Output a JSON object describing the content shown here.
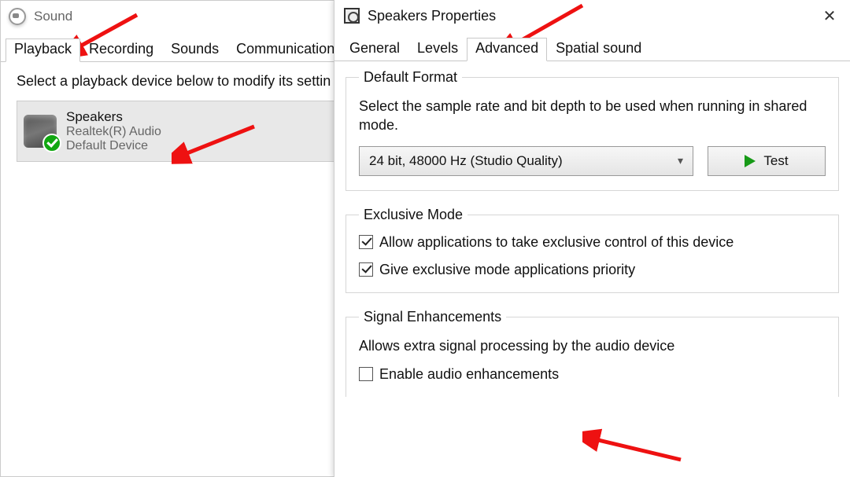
{
  "sound_dialog": {
    "title": "Sound",
    "tabs": [
      "Playback",
      "Recording",
      "Sounds",
      "Communications"
    ],
    "active_tab_index": 0,
    "instruction": "Select a playback device below to modify its settin",
    "device": {
      "name": "Speakers",
      "driver": "Realtek(R) Audio",
      "status": "Default Device"
    }
  },
  "props_dialog": {
    "title": "Speakers Properties",
    "tabs": [
      "General",
      "Levels",
      "Advanced",
      "Spatial sound"
    ],
    "active_tab_index": 2,
    "groups": {
      "default_format": {
        "legend": "Default Format",
        "description": "Select the sample rate and bit depth to be used when running in shared mode.",
        "selected": "24 bit, 48000 Hz (Studio Quality)",
        "test_label": "Test"
      },
      "exclusive_mode": {
        "legend": "Exclusive Mode",
        "allow_exclusive": {
          "label": "Allow applications to take exclusive control of this device",
          "checked": true
        },
        "give_priority": {
          "label": "Give exclusive mode applications priority",
          "checked": true
        }
      },
      "signal_enhancements": {
        "legend": "Signal Enhancements",
        "description": "Allows extra signal processing by the audio device",
        "enable": {
          "label": "Enable audio enhancements",
          "checked": false
        }
      }
    }
  }
}
